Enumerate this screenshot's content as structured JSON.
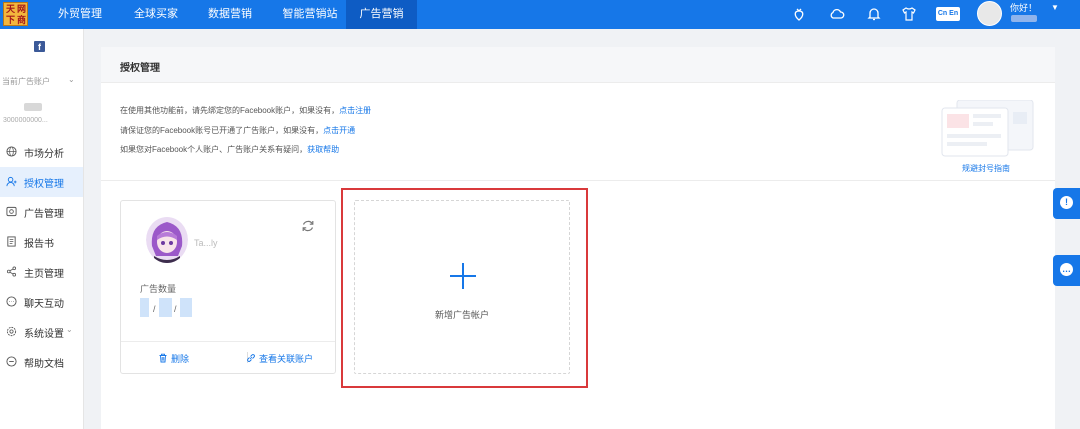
{
  "logo": {
    "chars": [
      "天",
      "下",
      "网",
      "商"
    ]
  },
  "nav": [
    {
      "label": "外贸管理",
      "active": false
    },
    {
      "label": "全球买家",
      "active": false
    },
    {
      "label": "数据营销",
      "active": false
    },
    {
      "label": "智能营销站",
      "active": false
    },
    {
      "label": "广告营销",
      "active": true
    }
  ],
  "topbar": {
    "icons": [
      "strawberry-icon",
      "cloud-icon",
      "bell-icon",
      "shirt-icon",
      "language-icon"
    ],
    "lang_label": "Cn En",
    "greeting": "你好！"
  },
  "sidebar": {
    "platform_icon": "f",
    "account_label": "当前广告账户",
    "account_id": "3000000000...",
    "items": [
      {
        "label": "市场分析",
        "icon": "globe-icon",
        "active": false
      },
      {
        "label": "授权管理",
        "icon": "user-icon",
        "active": true
      },
      {
        "label": "广告管理",
        "icon": "ad-icon",
        "active": false
      },
      {
        "label": "报告书",
        "icon": "report-icon",
        "active": false
      },
      {
        "label": "主页管理",
        "icon": "share-icon",
        "active": false
      },
      {
        "label": "聊天互动",
        "icon": "chat-icon",
        "active": false
      },
      {
        "label": "系统设置",
        "icon": "gear-icon",
        "active": false,
        "has_arrow": true
      },
      {
        "label": "帮助文档",
        "icon": "help-icon",
        "active": false
      }
    ]
  },
  "panel": {
    "title": "授权管理",
    "info": [
      {
        "text": "在使用其他功能前，请先绑定您的Facebook账户，如果没有，",
        "link": "点击注册"
      },
      {
        "text": "请保证您的Facebook账号已开通了广告账户，如果没有，",
        "link": "点击开通"
      },
      {
        "text": "如果您对Facebook个人账户、广告账户关系有疑问，",
        "link": "获取帮助"
      }
    ],
    "guide_link": "规避封号指南"
  },
  "account_card": {
    "name": "Ta...ly",
    "ad_count_label": "广告数量",
    "ad_count_separator": "/",
    "delete_label": "删除",
    "view_linked_label": "查看关联账户"
  },
  "add_account": {
    "label": "新增广告帐户"
  },
  "colors": {
    "primary": "#1677e8",
    "nav_active": "#0e5cc4",
    "highlight": "#d9393b"
  }
}
